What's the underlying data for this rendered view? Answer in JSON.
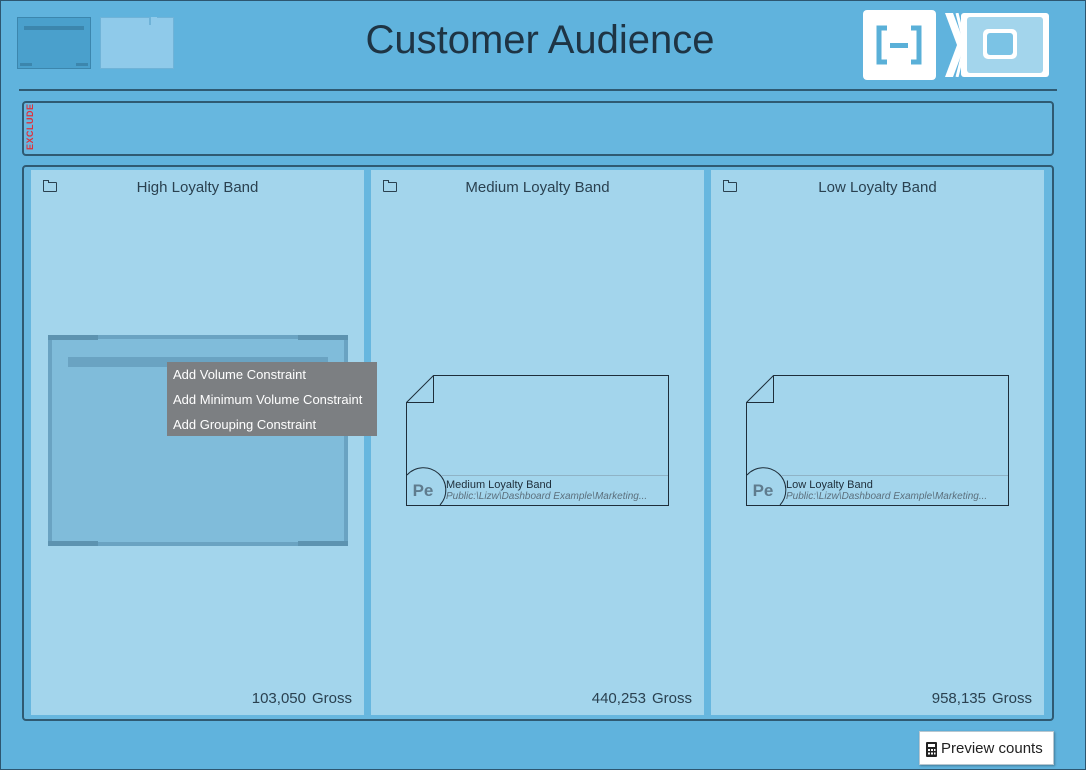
{
  "header": {
    "title": "Customer Audience"
  },
  "exclude_bar": {
    "label": "EXCLUDE"
  },
  "bands": [
    {
      "title": "High Loyalty Band",
      "count": "103,050",
      "count_unit": "Gross"
    },
    {
      "title": "Medium Loyalty Band",
      "count": "440,253",
      "count_unit": "Gross",
      "card": {
        "badge": "Pe",
        "name": "Medium Loyalty Band",
        "path": "Public:\\Lizw\\Dashboard Example\\Marketing..."
      }
    },
    {
      "title": "Low Loyalty Band",
      "count": "958,135",
      "count_unit": "Gross",
      "card": {
        "badge": "Pe",
        "name": "Low Loyalty Band",
        "path": "Public:\\Lizw\\Dashboard Example\\Marketing..."
      }
    }
  ],
  "context_menu": {
    "items": [
      "Add Volume Constraint",
      "Add Minimum Volume Constraint",
      "Add Grouping Constraint"
    ]
  },
  "footer": {
    "preview_label": "Preview counts"
  },
  "icons": {
    "band_icon": "folder-icon",
    "preview_icon": "calculator-icon",
    "view_toggle_left": "brackets-icon",
    "view_toggle_right": "card-icon"
  },
  "colors": {
    "background": "#60b3dd",
    "band": "#a3d5ec",
    "exclude_label": "#e0303a"
  }
}
